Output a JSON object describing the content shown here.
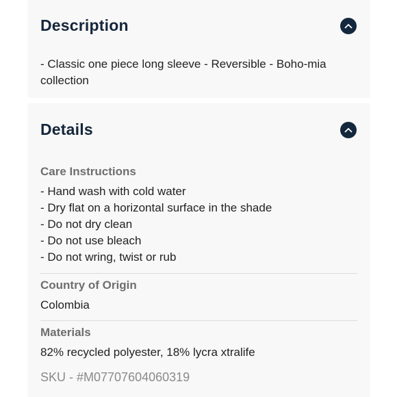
{
  "description": {
    "title": "Description",
    "text_line1": "- Classic one piece long sleeve - Reversible - Boho-mia",
    "text_line2": "collection"
  },
  "details": {
    "title": "Details",
    "care": {
      "heading": "Care Instructions",
      "items": [
        "- Hand wash with cold water",
        "- Dry flat on a horizontal surface in the shade",
        "- Do not dry clean",
        "- Do not use bleach",
        "- Do not wring, twist or rub"
      ]
    },
    "origin": {
      "heading": "Country of Origin",
      "value": "Colombia"
    },
    "materials": {
      "heading": "Materials",
      "value": "82% recycled polyester, 18% lycra xtralife"
    },
    "sku": "SKU - #M07707604060319"
  },
  "colors": {
    "accent": "#13273d",
    "panel_bg": "#f8f8f8"
  },
  "icons": {
    "toggle": "chevron-up-icon"
  }
}
